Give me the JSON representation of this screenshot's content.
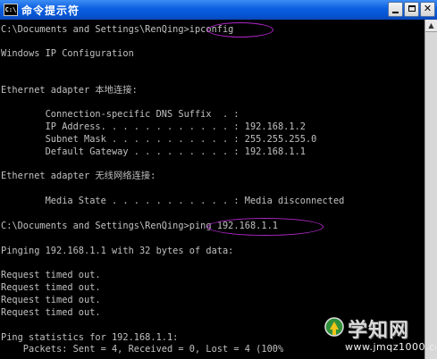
{
  "window": {
    "title": "命令提示符",
    "app_icon_label": "C:\\"
  },
  "console_lines": [
    "C:\\Documents and Settings\\RenQing>ipconfig",
    "",
    "Windows IP Configuration",
    "",
    "",
    "Ethernet adapter 本地连接:",
    "",
    "        Connection-specific DNS Suffix  . :",
    "        IP Address. . . . . . . . . . . . : 192.168.1.2",
    "        Subnet Mask . . . . . . . . . . . : 255.255.255.0",
    "        Default Gateway . . . . . . . . . : 192.168.1.1",
    "",
    "Ethernet adapter 无线网络连接:",
    "",
    "        Media State . . . . . . . . . . . : Media disconnected",
    "",
    "C:\\Documents and Settings\\RenQing>ping 192.168.1.1",
    "",
    "Pinging 192.168.1.1 with 32 bytes of data:",
    "",
    "Request timed out.",
    "Request timed out.",
    "Request timed out.",
    "Request timed out.",
    "",
    "Ping statistics for 192.168.1.1:",
    "    Packets: Sent = 4, Received = 0, Lost = 4 (100%"
  ],
  "watermark": {
    "brand": "学知网",
    "domain": "www.jmqz1000.com"
  },
  "colors": {
    "console_bg": "#000000",
    "console_text": "#c0c0c0",
    "title_bar": "#0653d1",
    "highlight_oval": "#b026c8"
  }
}
